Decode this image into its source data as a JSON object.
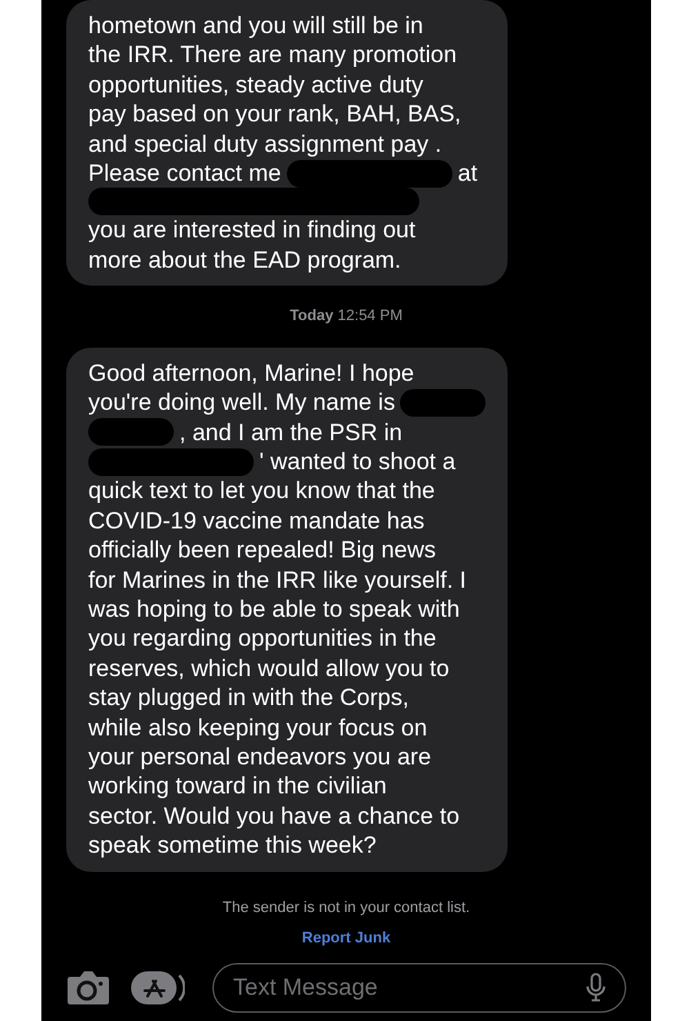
{
  "messages": [
    {
      "kind": "incoming",
      "lines": [
        [
          {
            "kind": "text",
            "text": "hometown and you will still be in"
          }
        ],
        [
          {
            "kind": "text",
            "text": "the IRR. There are many promotion"
          }
        ],
        [
          {
            "kind": "text",
            "text": "opportunities, steady active duty"
          }
        ],
        [
          {
            "kind": "text",
            "text": "pay based on your rank, BAH, BAS,"
          }
        ],
        [
          {
            "kind": "text",
            "text": "and special duty assignment pay ."
          }
        ],
        [
          {
            "kind": "text",
            "text": "Please contact me"
          },
          {
            "kind": "redaction"
          },
          {
            "kind": "text",
            "text": "at"
          }
        ],
        [
          {
            "kind": "long_redaction"
          }
        ],
        [
          {
            "kind": "text",
            "text": "you are interested in finding out"
          }
        ],
        [
          {
            "kind": "text",
            "text": "more about the EAD program."
          }
        ]
      ]
    },
    {
      "kind": "timestamp",
      "text": "**Today** 12:54 PM"
    },
    {
      "kind": "incoming",
      "lines": [
        [
          {
            "kind": "text",
            "text": "Good afternoon, Marine! I hope"
          }
        ],
        [
          {
            "kind": "text",
            "text": "you're doing well. My name is"
          },
          {
            "kind": "short_redaction"
          }
        ],
        [
          {
            "kind": "short_redaction"
          },
          {
            "kind": "text",
            "text": ", and I am the PSR in"
          }
        ],
        [
          {
            "kind": "redaction"
          },
          {
            "kind": "text",
            "text": "' wanted to shoot a"
          }
        ],
        [
          {
            "kind": "text",
            "text": "quick text to let you know that the"
          }
        ],
        [
          {
            "kind": "text",
            "text": "COVID-19 vaccine mandate has"
          }
        ],
        [
          {
            "kind": "text",
            "text": "officially been repealed! Big news"
          }
        ],
        [
          {
            "kind": "text",
            "text": "for Marines in the IRR like yourself. I"
          }
        ],
        [
          {
            "kind": "text",
            "text": "was hoping to be able to speak with"
          }
        ],
        [
          {
            "kind": "text",
            "text": "you regarding opportunities in the"
          }
        ],
        [
          {
            "kind": "text",
            "text": "reserves, which would allow you to"
          }
        ],
        [
          {
            "kind": "text",
            "text": "stay plugged in with the Corps,"
          }
        ],
        [
          {
            "kind": "text",
            "text": "while also keeping your focus on"
          }
        ],
        [
          {
            "kind": "text",
            "text": "your personal endeavors you are"
          }
        ],
        [
          {
            "kind": "text",
            "text": "working toward in the civilian"
          }
        ],
        [
          {
            "kind": "text",
            "text": "sector. Would you have a chance to"
          }
        ],
        [
          {
            "kind": "text",
            "text": "speak sometime this week?"
          }
        ]
      ]
    }
  ],
  "notice": "The sender is not in your contact list.",
  "report_link": "Report Junk",
  "composer": {
    "placeholder": "Text Message"
  }
}
